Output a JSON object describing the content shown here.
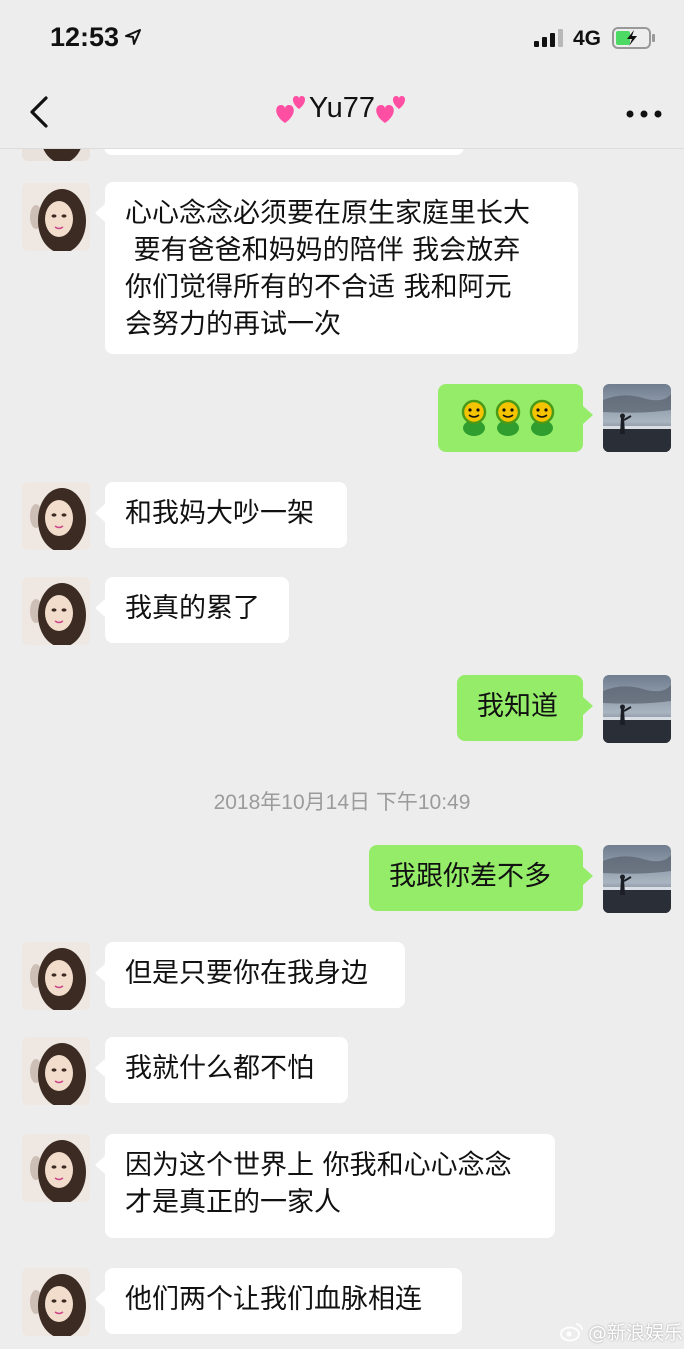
{
  "status_bar": {
    "time": "12:53",
    "network": "4G"
  },
  "nav": {
    "title": "Yu77"
  },
  "messages": [
    {
      "side": "left",
      "text": "心心念念必须要在原生家庭里长大\n 要有爸爸和妈妈的陪伴 我会放弃\n你们觉得所有的不合适 我和阿元\n会努力的再试一次"
    },
    {
      "side": "right",
      "emoji": "emoji-x3"
    },
    {
      "side": "left",
      "text": "和我妈大吵一架"
    },
    {
      "side": "left",
      "text": "我真的累了"
    },
    {
      "side": "right",
      "text": "我知道"
    },
    {
      "side": "right",
      "text": "我跟你差不多"
    },
    {
      "side": "left",
      "text": "但是只要你在我身边"
    },
    {
      "side": "left",
      "text": "我就什么都不怕"
    },
    {
      "side": "left",
      "text": "因为这个世界上 你我和心心念念\n才是真正的一家人"
    },
    {
      "side": "left",
      "text": "他们两个让我们血脉相连"
    }
  ],
  "timestamp": "2018年10月14日 下午10:49",
  "watermark": "@新浪娱乐",
  "colors": {
    "background": "#ededed",
    "left_bubble": "#ffffff",
    "right_bubble": "#95ec69"
  }
}
